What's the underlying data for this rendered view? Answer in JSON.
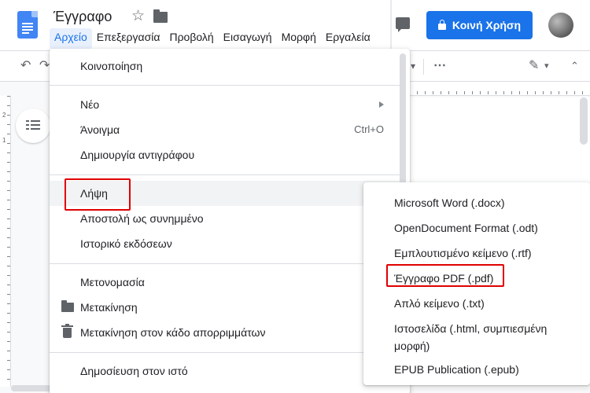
{
  "colors": {
    "accent": "#1a73e8",
    "highlight": "#e00000",
    "docs_blue": "#4285f4"
  },
  "header": {
    "doc_title": "Έγγραφο",
    "share_label": "Κοινή Χρήση"
  },
  "menubar": [
    "Αρχείο",
    "Επεξεργασία",
    "Προβολή",
    "Εισαγωγή",
    "Μορφή",
    "Εργαλεία"
  ],
  "ruler_numbers": [
    "2",
    "1"
  ],
  "file_menu": {
    "share": "Κοινοποίηση",
    "new": "Νέο",
    "open": "Άνοιγμα",
    "open_shortcut": "Ctrl+O",
    "make_copy": "Δημιουργία αντιγράφου",
    "download": "Λήψη",
    "email_attachment": "Αποστολή ως συνημμένο",
    "version_history": "Ιστορικό εκδόσεων",
    "rename": "Μετονομασία",
    "move": "Μετακίνηση",
    "move_to_trash": "Μετακίνηση στον κάδο απορριμμάτων",
    "publish_web": "Δημοσίευση στον ιστό"
  },
  "download_submenu": {
    "docx": "Microsoft Word (.docx)",
    "odt": "OpenDocument Format (.odt)",
    "rtf": "Εμπλουτισμένο κείμενο (.rtf)",
    "pdf": "Έγγραφο PDF (.pdf)",
    "txt": "Απλό κείμενο (.txt)",
    "html_line1": "Ιστοσελίδα (.html, συμπιεσμένη",
    "html_line2": "μορφή)",
    "epub": "EPUB Publication (.epub)"
  }
}
